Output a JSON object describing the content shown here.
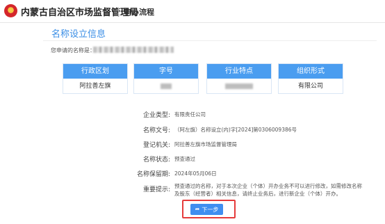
{
  "header": {
    "org_name": "内蒙古自治区市场监督管理局",
    "nav_title": "申办流程"
  },
  "section_title": "名称设立信息",
  "applied_name_label": "您申请的名称是：",
  "name_parts": [
    {
      "label": "行政区划",
      "value": "阿拉善左旗"
    },
    {
      "label": "字号",
      "value": ""
    },
    {
      "label": "行业特点",
      "value": ""
    },
    {
      "label": "组织形式",
      "value": "有限公司"
    }
  ],
  "details": [
    {
      "label": "企业类型:",
      "value": "有限责任公司"
    },
    {
      "label": "名称文号:",
      "value": "（阿左旗）名称设立(内)字[2024]第0306009386号"
    },
    {
      "label": "登记机关:",
      "value": "阿拉善左旗市场监督管理局"
    },
    {
      "label": "名称状态:",
      "value": "预查通过"
    },
    {
      "label": "名称保留期:",
      "value": "2024年05月06日"
    },
    {
      "label": "重要提示:",
      "value": "预查通过的名称，对于本次企业（个体）开办业务不可以进行修改，如需修改名称及股东（经营者）相关信息，请终止业务后，进行新企业（个体）开办。"
    }
  ],
  "next_button": {
    "label": "下一步",
    "icon": "share-arrow-icon"
  },
  "colors": {
    "accent": "#3f8ef0",
    "header_blue": "#4a9df0",
    "highlight": "#e53b3b"
  }
}
